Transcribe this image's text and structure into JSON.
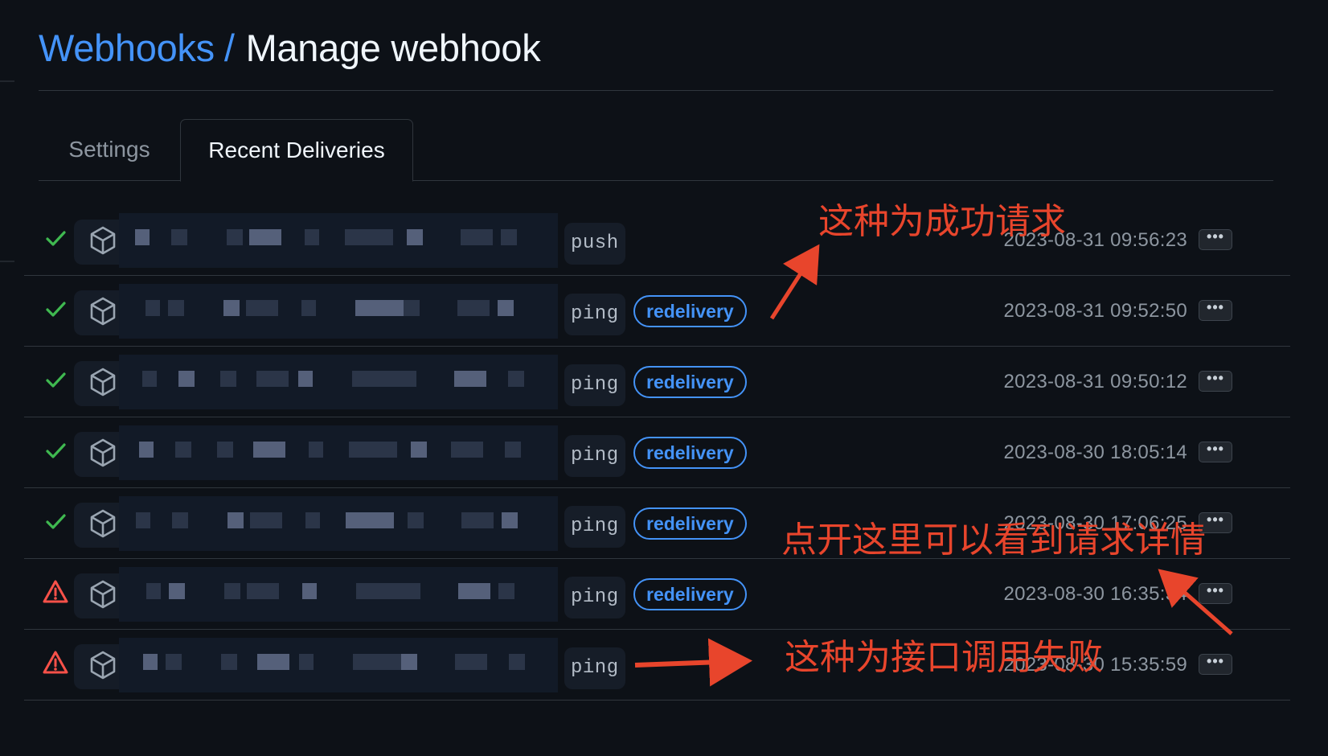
{
  "header": {
    "breadcrumb_label": "Webhooks",
    "separator": "/",
    "title": "Manage webhook"
  },
  "tabs": [
    {
      "label": "Settings",
      "active": false
    },
    {
      "label": "Recent Deliveries",
      "active": true
    }
  ],
  "deliveries": [
    {
      "status": "success",
      "event": "push",
      "redelivery": false,
      "timestamp": "2023-08-31 09:56:23",
      "more": "•••"
    },
    {
      "status": "success",
      "event": "ping",
      "redelivery": true,
      "badge": "redelivery",
      "timestamp": "2023-08-31 09:52:50",
      "more": "•••"
    },
    {
      "status": "success",
      "event": "ping",
      "redelivery": true,
      "badge": "redelivery",
      "timestamp": "2023-08-31 09:50:12",
      "more": "•••"
    },
    {
      "status": "success",
      "event": "ping",
      "redelivery": true,
      "badge": "redelivery",
      "timestamp": "2023-08-30 18:05:14",
      "more": "•••"
    },
    {
      "status": "success",
      "event": "ping",
      "redelivery": true,
      "badge": "redelivery",
      "timestamp": "2023-08-30 17:06:25",
      "more": "•••"
    },
    {
      "status": "failure",
      "event": "ping",
      "redelivery": true,
      "badge": "redelivery",
      "timestamp": "2023-08-30 16:35:34",
      "more": "•••"
    },
    {
      "status": "failure",
      "event": "ping",
      "redelivery": false,
      "timestamp": "2023-08-30 15:35:59",
      "more": "•••"
    }
  ],
  "annotations": {
    "success_note": "这种为成功请求",
    "details_note": "点开这里可以看到请求详情",
    "failure_note": "这种为接口调用失败"
  },
  "icons": {
    "success": "check-icon",
    "failure": "alert-icon",
    "package": "package-icon",
    "more": "kebab-horizontal-icon"
  },
  "colors": {
    "background": "#0d1117",
    "success": "#3fb950",
    "failure": "#f85149",
    "link": "#4493f8",
    "annotation": "#e8452c"
  }
}
